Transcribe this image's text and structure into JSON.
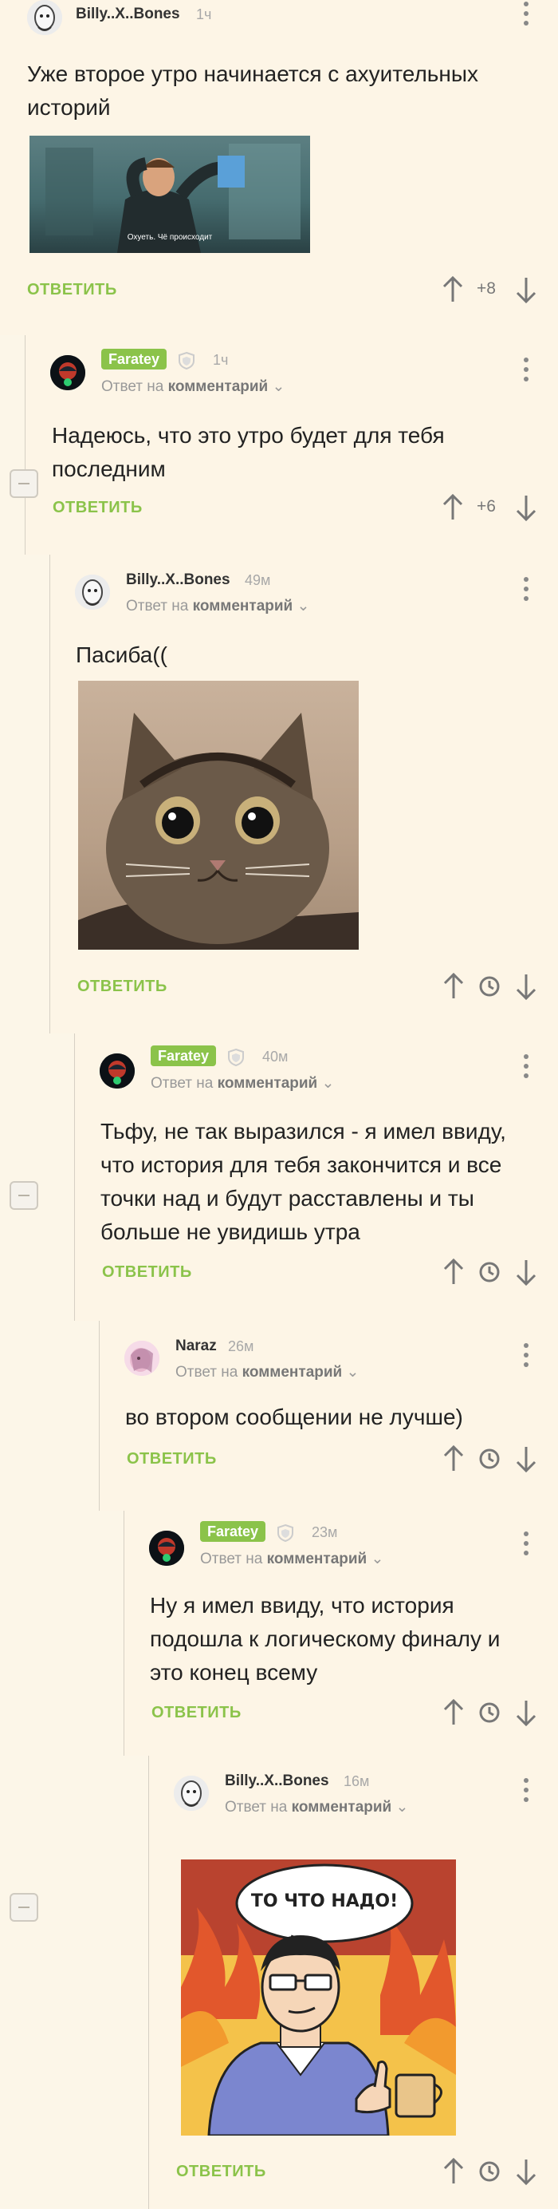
{
  "colors": {
    "background": "#fcf6e8",
    "accent": "#8bc34a",
    "rail": "#d6d0c4",
    "muted": "#a8a8a8"
  },
  "labels": {
    "reply": "ОТВЕТИТЬ",
    "reply_to_prefix": "Ответ на",
    "reply_to_link": "комментарий"
  },
  "comments": [
    {
      "user": "Billy..X..Bones",
      "time": "1ч",
      "text": "Уже второе утро начинается с ахуительных историй",
      "gif_caption": "Охуеть. Чё происходит",
      "score": "+8"
    },
    {
      "user": "Faratey",
      "time": "1ч",
      "text": "Надеюсь, что это утро будет для тебя последним",
      "score": "+6"
    },
    {
      "user": "Billy..X..Bones",
      "time": "49м",
      "text": "Пасиба(("
    },
    {
      "user": "Faratey",
      "time": "40м",
      "text": "Тьфу, не так выразился -  я имел ввиду, что история для тебя закончится и все точки над и будут расставлены и ты больше не увидишь утра"
    },
    {
      "user": "Naraz",
      "time": "26м",
      "text": "во втором сообщении не лучше)"
    },
    {
      "user": "Faratey",
      "time": "23м",
      "text": "Ну я имел ввиду, что история подошла к логическому финалу и это конец всему"
    },
    {
      "user": "Billy..X..Bones",
      "time": "16м",
      "meme_text": "ТО ЧТО НАДО!"
    }
  ]
}
